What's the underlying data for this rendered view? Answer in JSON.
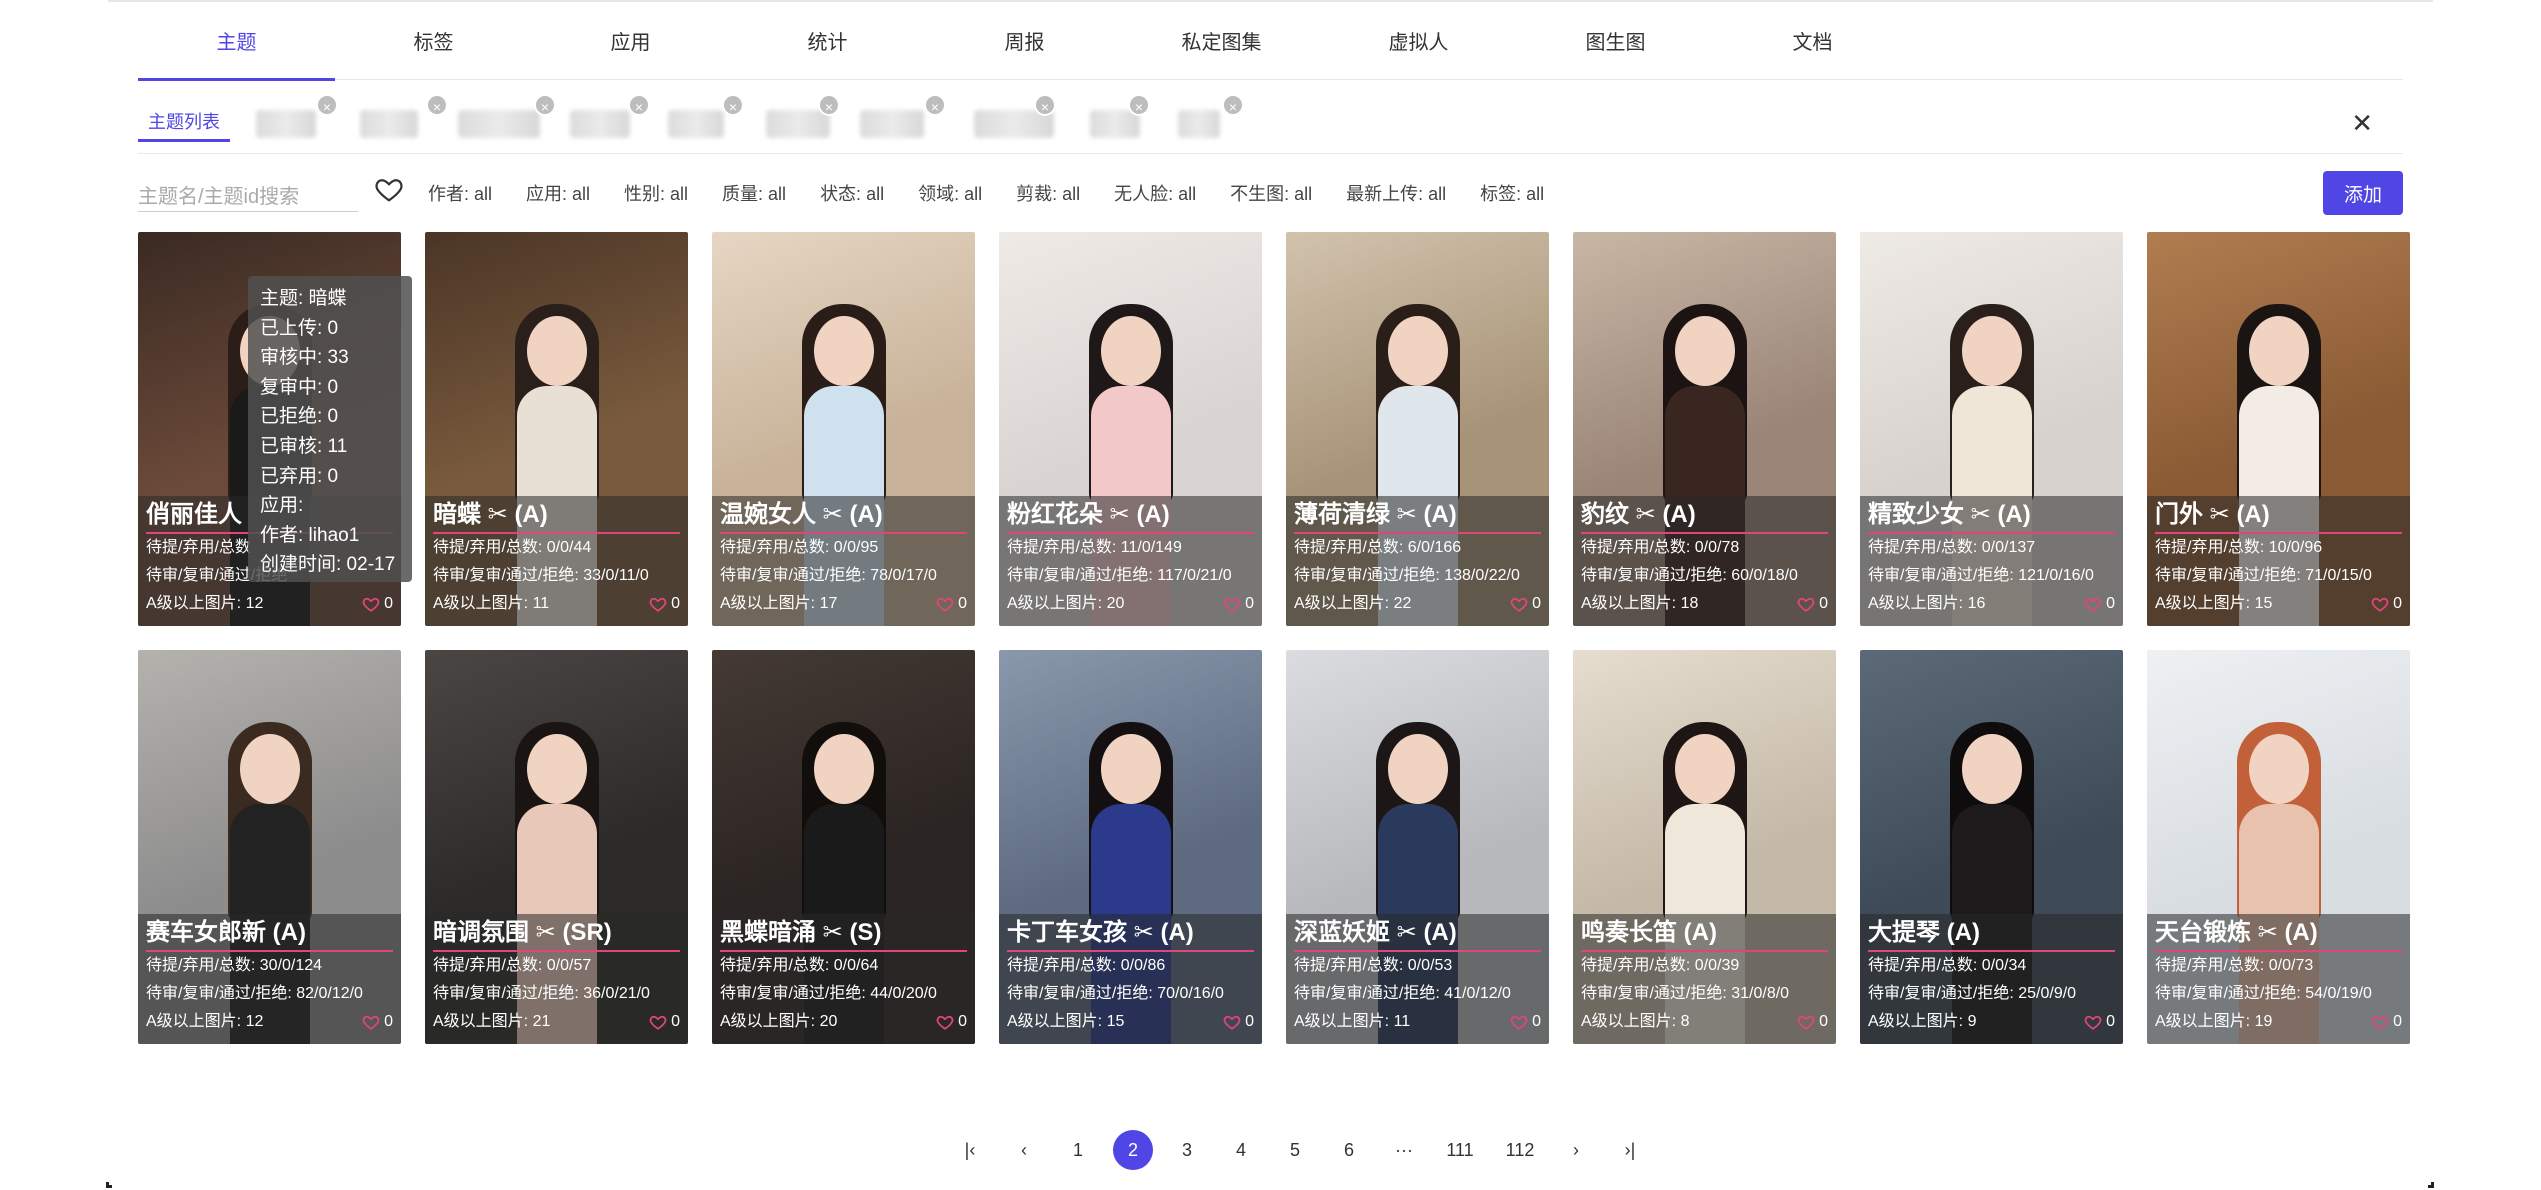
{
  "tabs": [
    "主题",
    "标签",
    "应用",
    "统计",
    "周报",
    "私定图集",
    "虚拟人",
    "图生图",
    "文档"
  ],
  "subtabs": {
    "active": "主题列表"
  },
  "search": {
    "placeholder": "主题名/主题id搜索"
  },
  "filters": [
    "作者: all",
    "应用: all",
    "性别: all",
    "质量: all",
    "状态: all",
    "领域: all",
    "剪裁: all",
    "无人脸: all",
    "不生图: all",
    "最新上传: all",
    "标签: all"
  ],
  "add_label": "添加",
  "tooltip": [
    "主题: 暗蝶",
    "已上传: 0",
    "审核中: 33",
    "复审中: 0",
    "已拒绝: 0",
    "已审核: 11",
    "已弃用: 0",
    "应用:",
    "作者: lihao1",
    "创建时间: 02-17"
  ],
  "cards": [
    {
      "title": "俏丽佳人",
      "scissor": false,
      "grade": "",
      "l1": "待提/弃用/总数",
      "l2": "待审/复审/通过/拒绝",
      "l3": "A级以上图片: 12",
      "likes": "0",
      "palette": [
        "#6b4a3a",
        "#3a2a22",
        "#2b1d18",
        "#1a1a1a"
      ]
    },
    {
      "title": "暗蝶",
      "scissor": true,
      "grade": "(A)",
      "l1": "待提/弃用/总数: 0/0/44",
      "l2": "待审/复审/通过/拒绝: 33/0/11/0",
      "l3": "A级以上图片: 11",
      "likes": "0",
      "palette": [
        "#7a5b3d",
        "#4a3526",
        "#2a1f1a",
        "#e8e0d4"
      ]
    },
    {
      "title": "温婉女人",
      "scissor": true,
      "grade": "(A)",
      "l1": "待提/弃用/总数: 0/0/95",
      "l2": "待审/复审/通过/拒绝: 78/0/17/0",
      "l3": "A级以上图片: 17",
      "likes": "0",
      "palette": [
        "#c7b198",
        "#e6d6c3",
        "#2a1d18",
        "#cfe0ee"
      ]
    },
    {
      "title": "粉红花朵",
      "scissor": true,
      "grade": "(A)",
      "l1": "待提/弃用/总数: 11/0/149",
      "l2": "待审/复审/通过/拒绝: 117/0/21/0",
      "l3": "A级以上图片: 20",
      "likes": "0",
      "palette": [
        "#d9d4d2",
        "#efeae6",
        "#1e1818",
        "#f2c8c8"
      ]
    },
    {
      "title": "薄荷清绿",
      "scissor": true,
      "grade": "(A)",
      "l1": "待提/弃用/总数: 6/0/166",
      "l2": "待审/复审/通过/拒绝: 138/0/22/0",
      "l3": "A级以上图片: 22",
      "likes": "0",
      "palette": [
        "#a79378",
        "#d2c3ad",
        "#2a1e18",
        "#dfe6ec"
      ]
    },
    {
      "title": "豹纹",
      "scissor": true,
      "grade": "(A)",
      "l1": "待提/弃用/总数: 0/0/78",
      "l2": "待审/复审/通过/拒绝: 60/0/18/0",
      "l3": "A级以上图片: 18",
      "likes": "0",
      "palette": [
        "#9a8576",
        "#c9b7a6",
        "#1b1412",
        "#3a2620"
      ]
    },
    {
      "title": "精致少女",
      "scissor": true,
      "grade": "(A)",
      "l1": "待提/弃用/总数: 0/0/137",
      "l2": "待审/复审/通过/拒绝: 121/0/16/0",
      "l3": "A级以上图片: 16",
      "likes": "0",
      "palette": [
        "#d8d2ce",
        "#eeeae6",
        "#2a1f1a",
        "#efe6d8"
      ]
    },
    {
      "title": "门外",
      "scissor": true,
      "grade": "(A)",
      "l1": "待提/弃用/总数: 10/0/96",
      "l2": "待审/复审/通过/拒绝: 71/0/15/0",
      "l3": "A级以上图片: 15",
      "likes": "0",
      "palette": [
        "#8a5a34",
        "#b07d50",
        "#1a1412",
        "#f2ece4"
      ]
    },
    {
      "title": "赛车女郎新",
      "scissor": false,
      "grade": "(A)",
      "l1": "待提/弃用/总数: 30/0/124",
      "l2": "待审/复审/通过/拒绝: 82/0/12/0",
      "l3": "A级以上图片: 12",
      "likes": "0",
      "palette": [
        "#8d8d8d",
        "#b5b2ae",
        "#3a2a20",
        "#222222"
      ]
    },
    {
      "title": "暗调氛围",
      "scissor": true,
      "grade": "(SR)",
      "l1": "待提/弃用/总数: 0/0/57",
      "l2": "待审/复审/通过/拒绝: 36/0/21/0",
      "l3": "A级以上图片: 21",
      "likes": "0",
      "palette": [
        "#2c2a29",
        "#4a4644",
        "#1a1412",
        "#e8c8b8"
      ]
    },
    {
      "title": "黑蝶暗涌",
      "scissor": true,
      "grade": "(S)",
      "l1": "待提/弃用/总数: 0/0/64",
      "l2": "待审/复审/通过/拒绝: 44/0/20/0",
      "l3": "A级以上图片: 20",
      "likes": "0",
      "palette": [
        "#2a2422",
        "#453a34",
        "#120e0c",
        "#1a1a1a"
      ]
    },
    {
      "title": "卡丁车女孩",
      "scissor": true,
      "grade": "(A)",
      "l1": "待提/弃用/总数: 0/0/86",
      "l2": "待审/复审/通过/拒绝: 70/0/16/0",
      "l3": "A级以上图片: 15",
      "likes": "0",
      "palette": [
        "#5d6a80",
        "#8a98ac",
        "#141012",
        "#2c3a8c"
      ]
    },
    {
      "title": "深蓝妖姬",
      "scissor": true,
      "grade": "(A)",
      "l1": "待提/弃用/总数: 0/0/53",
      "l2": "待审/复审/通过/拒绝: 41/0/12/0",
      "l3": "A级以上图片: 11",
      "likes": "0",
      "palette": [
        "#b7b9bd",
        "#dadcdf",
        "#1c1616",
        "#2a3a5c"
      ]
    },
    {
      "title": "鸣奏长笛",
      "scissor": false,
      "grade": "(A)",
      "l1": "待提/弃用/总数: 0/0/39",
      "l2": "待审/复审/通过/拒绝: 31/0/8/0",
      "l3": "A级以上图片: 8",
      "likes": "0",
      "palette": [
        "#c4b8a6",
        "#e6ddd0",
        "#1e1614",
        "#efe8da"
      ]
    },
    {
      "title": "大提琴",
      "scissor": false,
      "grade": "(A)",
      "l1": "待提/弃用/总数: 0/0/34",
      "l2": "待审/复审/通过/拒绝: 25/0/9/0",
      "l3": "A级以上图片: 9",
      "likes": "0",
      "palette": [
        "#3e4a58",
        "#5c6a78",
        "#0e0c0c",
        "#1c1a1a"
      ]
    },
    {
      "title": "天台锻炼",
      "scissor": true,
      "grade": "(A)",
      "l1": "待提/弃用/总数: 0/0/73",
      "l2": "待审/复审/通过/拒绝: 54/0/19/0",
      "l3": "A级以上图片: 19",
      "likes": "0",
      "palette": [
        "#d8dde2",
        "#eef0f2",
        "#c2603a",
        "#e8c2ac"
      ]
    }
  ],
  "pagination": {
    "pages": [
      "1",
      "2",
      "3",
      "4",
      "5",
      "6",
      "···",
      "111",
      "112"
    ],
    "current": "2"
  },
  "colors": {
    "accent": "#4f46e5",
    "title_underline": "#e0457b",
    "heart": "#e0457b"
  },
  "icons": [
    "heart-outline-icon",
    "scissors-icon",
    "close-icon",
    "first-page-icon",
    "prev-page-icon",
    "next-page-icon",
    "last-page-icon"
  ]
}
